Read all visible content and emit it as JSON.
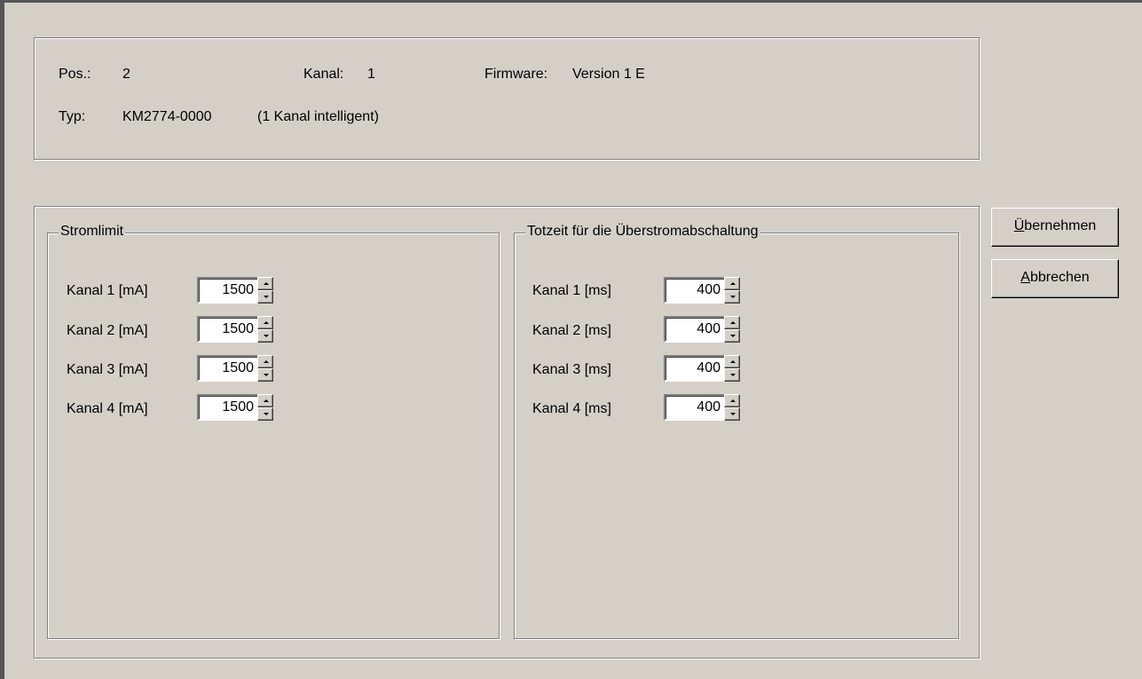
{
  "info": {
    "pos_label": "Pos.:",
    "pos_value": "2",
    "kanal_label": "Kanal:",
    "kanal_value": "1",
    "firmware_label": "Firmware:",
    "firmware_value": "Version 1 E",
    "typ_label": "Typ:",
    "typ_value": "KM2774-0000",
    "typ_desc": "(1 Kanal intelligent)"
  },
  "stromlimit": {
    "title": "Stromlimit",
    "rows": [
      {
        "label": "Kanal 1 [mA]",
        "value": "1500"
      },
      {
        "label": "Kanal 2 [mA]",
        "value": "1500"
      },
      {
        "label": "Kanal 3 [mA]",
        "value": "1500"
      },
      {
        "label": "Kanal 4 [mA]",
        "value": "1500"
      }
    ]
  },
  "totzeit": {
    "title": "Totzeit für die Überstromabschaltung",
    "rows": [
      {
        "label": "Kanal 1 [ms]",
        "value": "400"
      },
      {
        "label": "Kanal 2 [ms]",
        "value": "400"
      },
      {
        "label": "Kanal 3 [ms]",
        "value": "400"
      },
      {
        "label": "Kanal 4 [ms]",
        "value": "400"
      }
    ]
  },
  "buttons": {
    "apply_first": "Ü",
    "apply_rest": "bernehmen",
    "cancel_first": "A",
    "cancel_rest": "bbrechen"
  }
}
